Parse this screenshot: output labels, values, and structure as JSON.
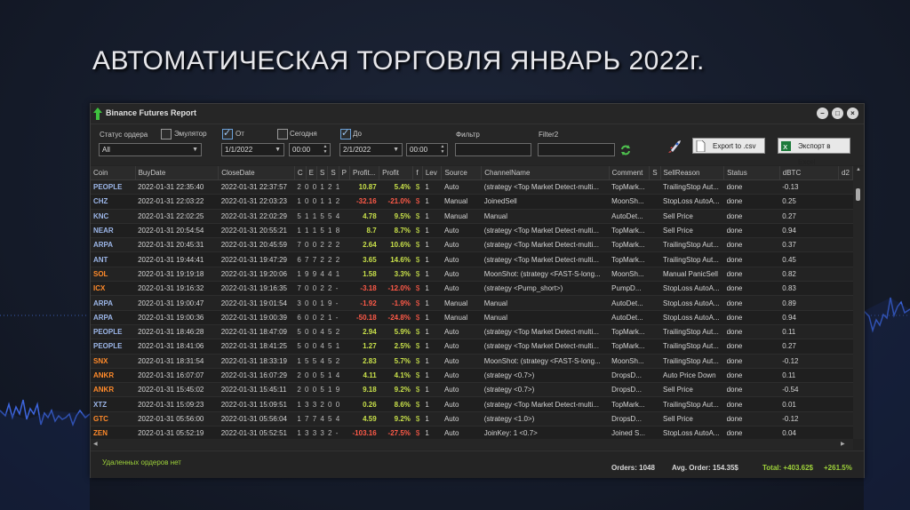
{
  "slide_title": "АВТОМАТИЧЕСКАЯ ТОРГОВЛЯ ЯНВАРЬ 2022г.",
  "window": {
    "title": "Binance Futures Report"
  },
  "filters": {
    "order_status_label": "Статус ордера",
    "order_status_value": "All",
    "emulator_label": "Эмулятор",
    "from_label": "От",
    "from_date": "1/1/2022",
    "from_time": "00:00",
    "today_label": "Сегодня",
    "to_label": "До",
    "to_date": "2/1/2022",
    "to_time": "00:00",
    "filter_label": "Фильтр",
    "filter2_label": "Filter2",
    "export_csv_label": "Export to .csv",
    "export_excel_label": "Экспорт в Excel"
  },
  "columns": [
    "Coin",
    "BuyDate",
    "CloseDate",
    "С",
    "Е",
    "S",
    "S",
    "Р",
    "Profit...",
    "Profit",
    "f",
    "Lev",
    "Source",
    "ChannelName",
    "Comment",
    "S",
    "SellReason",
    "Status",
    "dBTC",
    "d2"
  ],
  "rows": [
    {
      "coin": "PEOPLE",
      "buy": "2022-01-31 22:35:40",
      "close": "2022-01-31 22:37:57",
      "mini": "2 0 0 1 2 1",
      "p1": "10.87",
      "p2": "5.4%",
      "lev": "1",
      "source": "Auto",
      "channel": "(strategy <Top Market Detect-multi...",
      "comment": "TopMark...",
      "reason": "TrailingStop Aut...",
      "status": "done",
      "dbtc": "-0.13"
    },
    {
      "coin": "CHZ",
      "buy": "2022-01-31 22:03:22",
      "close": "2022-01-31 22:03:23",
      "mini": "1 0 0 1 1 2",
      "p1": "-32.16",
      "p2": "-21.0%",
      "lev": "1",
      "source": "Manual",
      "channel": "JoinedSell",
      "comment": "MoonSh...",
      "reason": "StopLoss AutoA...",
      "status": "done",
      "dbtc": "0.25"
    },
    {
      "coin": "KNC",
      "buy": "2022-01-31 22:02:25",
      "close": "2022-01-31 22:02:29",
      "mini": "5 1 1 5 5 4",
      "p1": "4.78",
      "p2": "9.5%",
      "lev": "1",
      "source": "Manual",
      "channel": "Manual",
      "comment": "AutoDet...",
      "reason": "Sell Price",
      "status": "done",
      "dbtc": "0.27"
    },
    {
      "coin": "NEAR",
      "buy": "2022-01-31 20:54:54",
      "close": "2022-01-31 20:55:21",
      "mini": "1 1 1 5 1 8",
      "p1": "8.7",
      "p2": "8.7%",
      "lev": "1",
      "source": "Auto",
      "channel": "(strategy <Top Market Detect-multi...",
      "comment": "TopMark...",
      "reason": "Sell Price",
      "status": "done",
      "dbtc": "0.94"
    },
    {
      "coin": "ARPA",
      "buy": "2022-01-31 20:45:31",
      "close": "2022-01-31 20:45:59",
      "mini": "7 0 0 2 2 2",
      "p1": "2.64",
      "p2": "10.6%",
      "lev": "1",
      "source": "Auto",
      "channel": "(strategy <Top Market Detect-multi...",
      "comment": "TopMark...",
      "reason": "TrailingStop Aut...",
      "status": "done",
      "dbtc": "0.37"
    },
    {
      "coin": "ANT",
      "buy": "2022-01-31 19:44:41",
      "close": "2022-01-31 19:47:29",
      "mini": "6 7 7 2 2 2",
      "p1": "3.65",
      "p2": "14.6%",
      "lev": "1",
      "source": "Auto",
      "channel": "(strategy <Top Market Detect-multi...",
      "comment": "TopMark...",
      "reason": "TrailingStop Aut...",
      "status": "done",
      "dbtc": "0.45"
    },
    {
      "coin": "SOL",
      "buy": "2022-01-31 19:19:18",
      "close": "2022-01-31 19:20:06",
      "mini": "1 9 9 4 4 1",
      "p1": "1.58",
      "p2": "3.3%",
      "lev": "1",
      "source": "Auto",
      "channel": "MoonShot: (strategy <FAST-S-long...",
      "comment": "MoonSh...",
      "reason": "Manual PanicSell",
      "status": "done",
      "dbtc": "0.82"
    },
    {
      "coin": "ICX",
      "buy": "2022-01-31 19:16:32",
      "close": "2022-01-31 19:16:35",
      "mini": "7 0 0 2 2 -",
      "p1": "-3.18",
      "p2": "-12.0%",
      "lev": "1",
      "source": "Auto",
      "channel": "(strategy <Pump_short>)",
      "comment": "PumpD...",
      "reason": "StopLoss AutoA...",
      "status": "done",
      "dbtc": "0.83"
    },
    {
      "coin": "ARPA",
      "buy": "2022-01-31 19:00:47",
      "close": "2022-01-31 19:01:54",
      "mini": "3 0 0 1 9 -",
      "p1": "-1.92",
      "p2": "-1.9%",
      "lev": "1",
      "source": "Manual",
      "channel": "Manual",
      "comment": "AutoDet...",
      "reason": "StopLoss AutoA...",
      "status": "done",
      "dbtc": "0.89"
    },
    {
      "coin": "ARPA",
      "buy": "2022-01-31 19:00:36",
      "close": "2022-01-31 19:00:39",
      "mini": "6 0 0 2 1 -",
      "p1": "-50.18",
      "p2": "-24.8%",
      "lev": "1",
      "source": "Manual",
      "channel": "Manual",
      "comment": "AutoDet...",
      "reason": "StopLoss AutoA...",
      "status": "done",
      "dbtc": "0.94"
    },
    {
      "coin": "PEOPLE",
      "buy": "2022-01-31 18:46:28",
      "close": "2022-01-31 18:47:09",
      "mini": "5 0 0 4 5 2",
      "p1": "2.94",
      "p2": "5.9%",
      "lev": "1",
      "source": "Auto",
      "channel": "(strategy <Top Market Detect-multi...",
      "comment": "TopMark...",
      "reason": "TrailingStop Aut...",
      "status": "done",
      "dbtc": "0.11"
    },
    {
      "coin": "PEOPLE",
      "buy": "2022-01-31 18:41:06",
      "close": "2022-01-31 18:41:25",
      "mini": "5 0 0 4 5 1",
      "p1": "1.27",
      "p2": "2.5%",
      "lev": "1",
      "source": "Auto",
      "channel": "(strategy <Top Market Detect-multi...",
      "comment": "TopMark...",
      "reason": "TrailingStop Aut...",
      "status": "done",
      "dbtc": "0.27"
    },
    {
      "coin": "SNX",
      "buy": "2022-01-31 18:31:54",
      "close": "2022-01-31 18:33:19",
      "mini": "1 5 5 4 5 2",
      "p1": "2.83",
      "p2": "5.7%",
      "lev": "1",
      "source": "Auto",
      "channel": "MoonShot: (strategy <FAST-S-long...",
      "comment": "MoonSh...",
      "reason": "TrailingStop Aut...",
      "status": "done",
      "dbtc": "-0.12"
    },
    {
      "coin": "ANKR",
      "buy": "2022-01-31 16:07:07",
      "close": "2022-01-31 16:07:29",
      "mini": "2 0 0 5 1 4",
      "p1": "4.11",
      "p2": "4.1%",
      "lev": "1",
      "source": "Auto",
      "channel": "(strategy <0.7>)",
      "comment": "DropsD...",
      "reason": "Auto Price Down",
      "status": "done",
      "dbtc": "0.11"
    },
    {
      "coin": "ANKR",
      "buy": "2022-01-31 15:45:02",
      "close": "2022-01-31 15:45:11",
      "mini": "2 0 0 5 1 9",
      "p1": "9.18",
      "p2": "9.2%",
      "lev": "1",
      "source": "Auto",
      "channel": "(strategy <0.7>)",
      "comment": "DropsD...",
      "reason": "Sell Price",
      "status": "done",
      "dbtc": "-0.54"
    },
    {
      "coin": "XTZ",
      "buy": "2022-01-31 15:09:23",
      "close": "2022-01-31 15:09:51",
      "mini": "1 3 3 2 0 0",
      "p1": "0.26",
      "p2": "8.6%",
      "lev": "1",
      "source": "Auto",
      "channel": "(strategy <Top Market Detect-multi...",
      "comment": "TopMark...",
      "reason": "TrailingStop Aut...",
      "status": "done",
      "dbtc": "0.01"
    },
    {
      "coin": "GTC",
      "buy": "2022-01-31 05:56:00",
      "close": "2022-01-31 05:56:04",
      "mini": "1 7 7 4 5 4",
      "p1": "4.59",
      "p2": "9.2%",
      "lev": "1",
      "source": "Auto",
      "channel": "(strategy <1.0>)",
      "comment": "DropsD...",
      "reason": "Sell Price",
      "status": "done",
      "dbtc": "-0.12"
    },
    {
      "coin": "ZEN",
      "buy": "2022-01-31 05:52:19",
      "close": "2022-01-31 05:52:51",
      "mini": "1 3 3 3 2 -",
      "p1": "-103.16",
      "p2": "-27.5%",
      "lev": "1",
      "source": "Auto",
      "channel": "JoinKey: 1  <0.7>",
      "comment": "Joined S...",
      "reason": "StopLoss AutoA...",
      "status": "done",
      "dbtc": "0.04"
    }
  ],
  "status_bar": {
    "deleted": "Удаленных ордеров нет",
    "orders": "Orders: 1048",
    "avg": "Avg. Order:  154.35$",
    "total": "Total: +403.62$",
    "total_pct": "+261.5%"
  },
  "colors": {
    "coin_blue": "#9cb6e8",
    "coin_orange": "#ff8a2a",
    "profit_green": "#c8e04a",
    "loss_red": "#ff5a48",
    "total_green": "#9ed23a"
  }
}
